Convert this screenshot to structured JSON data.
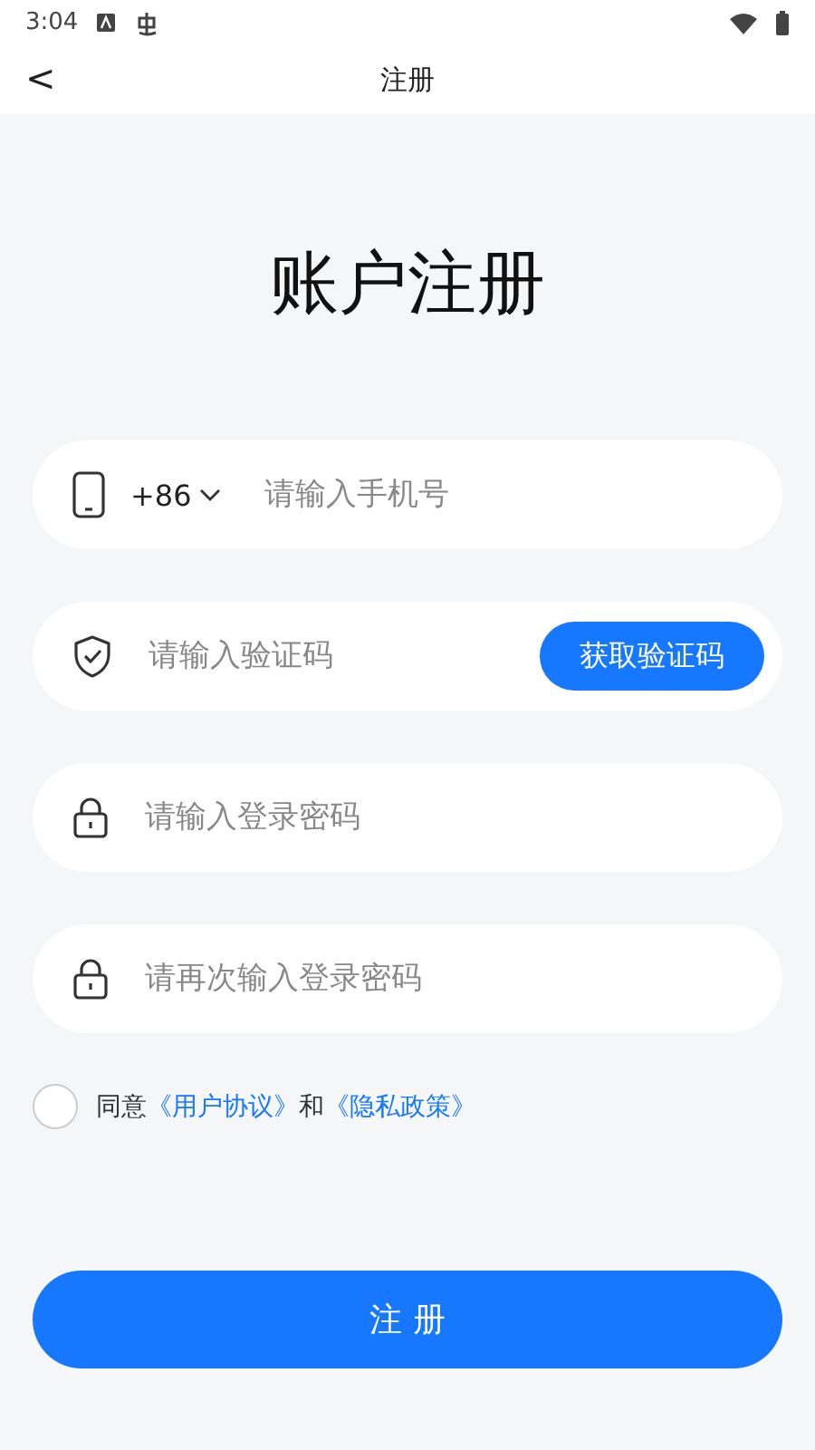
{
  "status_bar": {
    "time": "3:04"
  },
  "header": {
    "back": "<",
    "title": "注册"
  },
  "heading": "账户注册",
  "fields": [
    {
      "kind": "phone",
      "country_code": "+86",
      "placeholder": "请输入手机号"
    },
    {
      "kind": "code",
      "placeholder": "请输入验证码",
      "button": "获取验证码"
    },
    {
      "kind": "password",
      "placeholder": "请输入登录密码"
    },
    {
      "kind": "password",
      "placeholder": "请再次输入登录密码"
    }
  ],
  "agreement": {
    "checked": false,
    "prefix": "同意",
    "link_1": "《用户协议》",
    "middle": "和",
    "link_2": "《隐私政策》"
  },
  "submit": "注 册"
}
